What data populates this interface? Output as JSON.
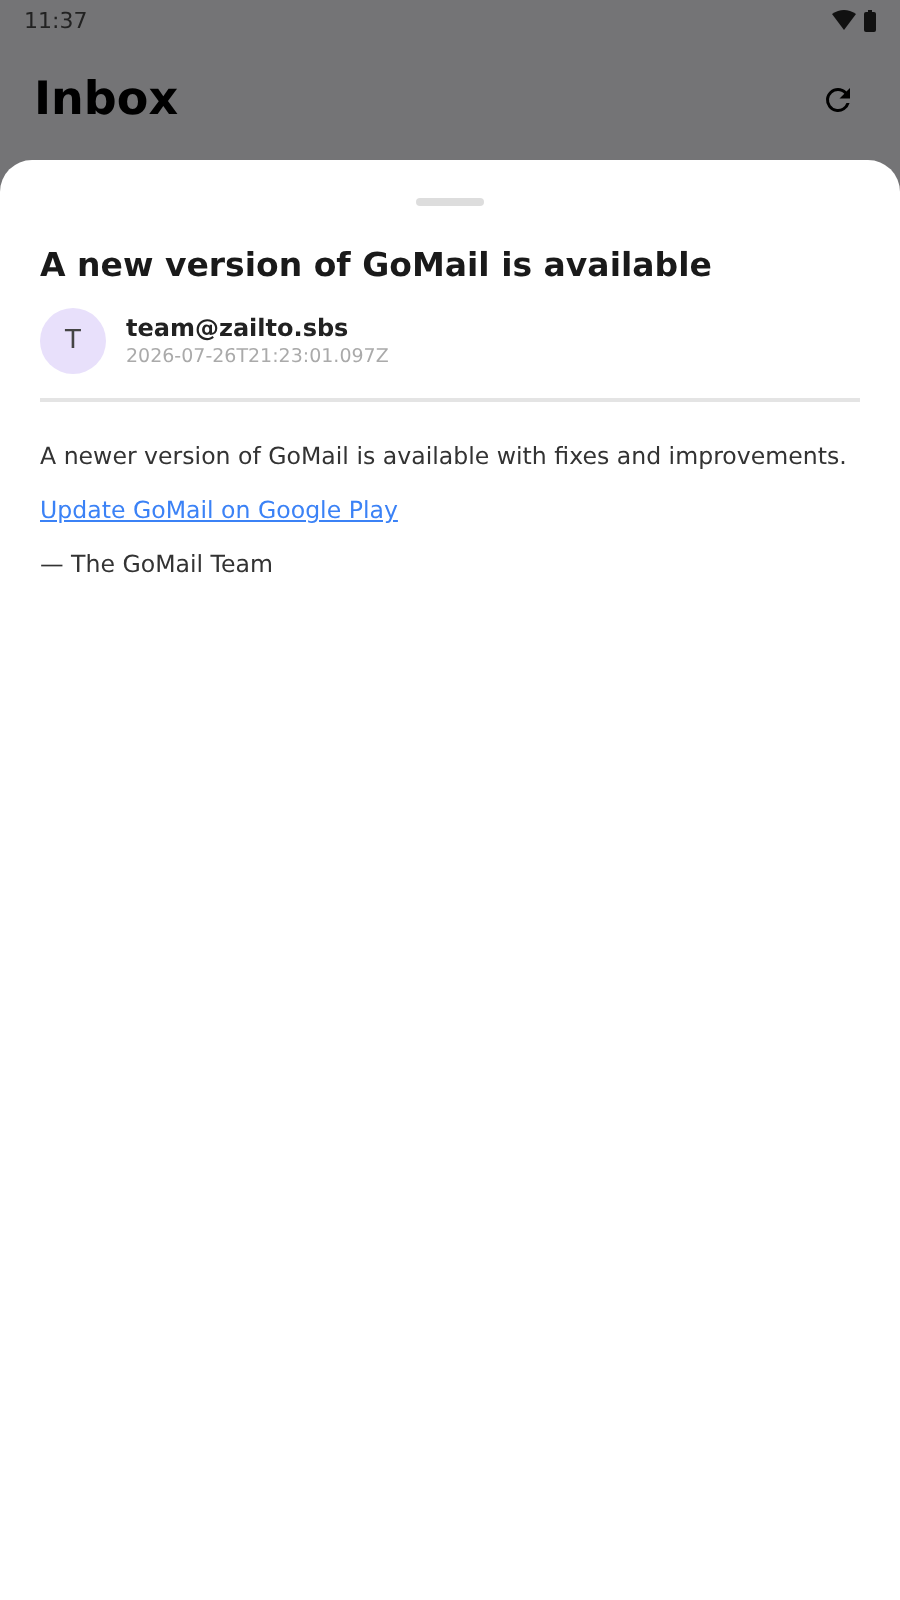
{
  "status_bar": {
    "time": "11:37"
  },
  "header": {
    "title": "Inbox"
  },
  "message": {
    "subject": "A new version of GoMail is available",
    "sender": {
      "initial": "T",
      "address": "team@zailto.sbs",
      "timestamp": "2026-07-26T21:23:01.097Z"
    },
    "body": [
      {
        "kind": "text",
        "text": "A newer version of GoMail is available with fixes and improvements."
      },
      {
        "kind": "link",
        "text": "Update GoMail on Google Play"
      },
      {
        "kind": "text",
        "text": "— The GoMail Team"
      }
    ]
  }
}
